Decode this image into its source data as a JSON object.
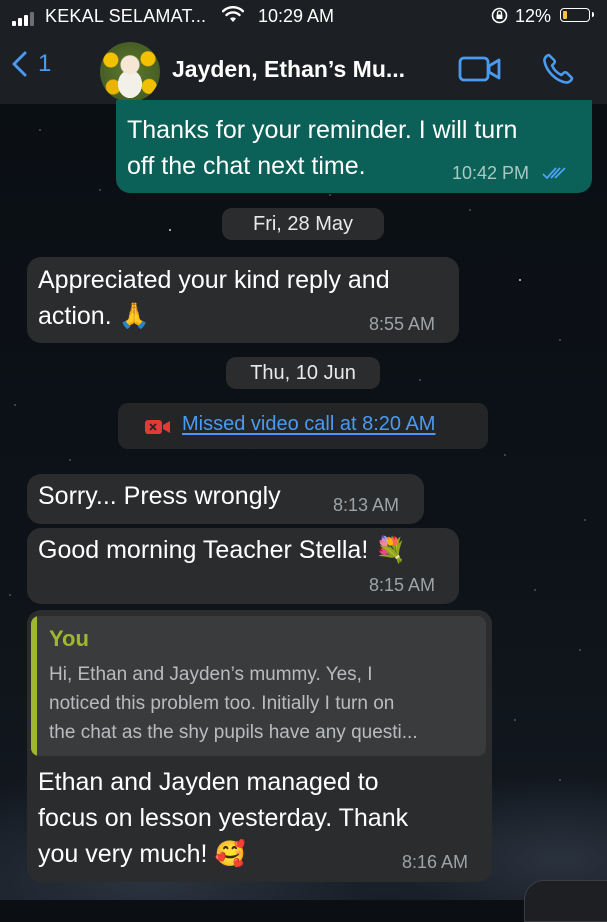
{
  "status_bar": {
    "carrier": "KEKAL SELAMAT...",
    "time": "10:29 AM",
    "battery": "12%",
    "battery_level": 0.12,
    "icons": [
      "signal-icon",
      "wifi-icon",
      "rotation-lock-icon",
      "battery-icon"
    ]
  },
  "header": {
    "back_count": "1",
    "title": "Jayden, Ethan’s Mu...",
    "icons": [
      "back-chevron-icon",
      "video-call-icon",
      "phone-icon"
    ],
    "accent_color": "#4a9bf0"
  },
  "messages": [
    {
      "type": "outgoing",
      "text": "Thanks for your reminder. I will turn\noff the chat next time.",
      "time": "10:42 PM",
      "status": "read"
    },
    {
      "type": "date",
      "label": "Fri, 28 May"
    },
    {
      "type": "incoming",
      "text": "Appreciated your kind reply and\naction. 🙏",
      "time": "8:55 AM"
    },
    {
      "type": "date",
      "label": "Thu, 10 Jun"
    },
    {
      "type": "system",
      "text": "Missed video call at 8:20 AM",
      "icon": "missed-video-call-icon"
    },
    {
      "type": "incoming",
      "text": "Sorry... Press wrongly",
      "time": "8:13 AM"
    },
    {
      "type": "incoming",
      "text": "Good morning Teacher Stella! 💐",
      "time": "8:15 AM"
    },
    {
      "type": "incoming",
      "quote_author": "You",
      "quote_text": "Hi, Ethan and Jayden’s mummy. Yes, I\nnoticed this problem too. Initially I turn on\nthe chat as the shy pupils have any questi...",
      "text": "Ethan and Jayden managed to\nfocus on lesson yesterday. Thank\nyou very much! 🥰",
      "time": "8:16 AM"
    }
  ],
  "colors": {
    "incoming_bubble": "#2b2c2e",
    "outgoing_bubble": "#0b6157",
    "quote_accent": "#9fb72c",
    "missed_call_icon": "#e53935"
  }
}
